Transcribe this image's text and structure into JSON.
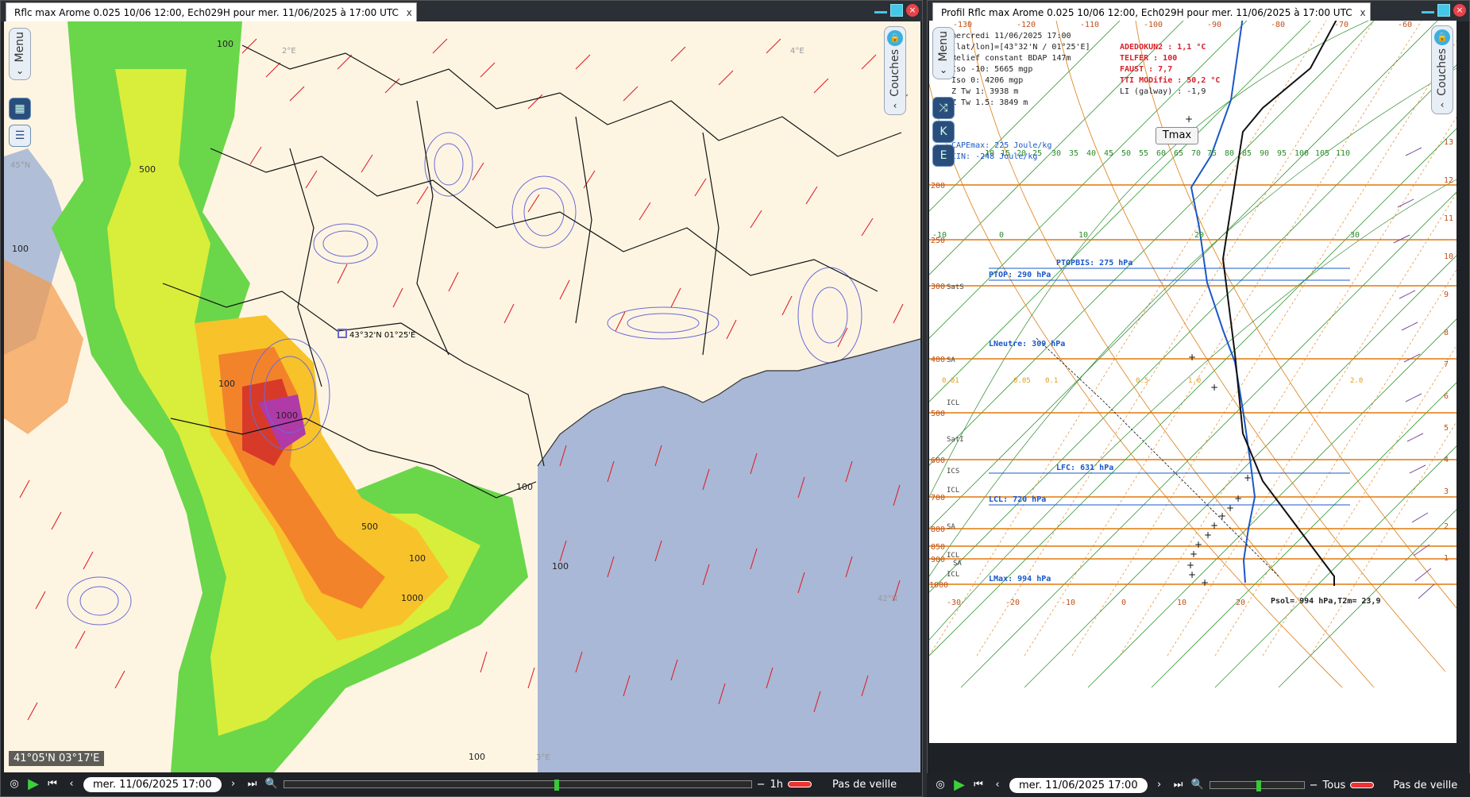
{
  "left_window": {
    "title": "Rflc max Arome 0.025 10/06 12:00, Ech029H pour mer. 11/06/2025 à 17:00 UTC",
    "tab_close": "x",
    "menu_label": "Menu",
    "layers_label": "Couches",
    "point_label": "43°32'N 01°25'E",
    "cursor_coord": "41°05'N 03°17'E",
    "contour_labels": [
      "100",
      "500",
      "100",
      "100",
      "1000",
      "500",
      "100",
      "100",
      "100",
      "1000",
      "100"
    ],
    "map_ticks": [
      "45°N",
      "2°E",
      "4°E",
      "42°N",
      "3°E"
    ],
    "controls": {
      "date": "mer. 11/06/2025 17:00",
      "step": "1h",
      "minus": "−",
      "watch": "Pas de veille"
    }
  },
  "right_window": {
    "title": "Profil Rflc max Arome 0.025 10/06 12:00, Ech029H pour mer. 11/06/2025 à 17:00 UTC",
    "tab_close": "x",
    "menu_label": "Menu",
    "layers_label": "Couches",
    "tmax_button": "Tmax",
    "info": {
      "date": "mercredi 11/06/2025 17:00",
      "latlon": "[lat/lon]=[43°32'N / 01°25'E]",
      "relief": "Relief constant BDAP  147m",
      "iso_m10": "Iso -10: 5665 mgp",
      "iso_0": "Iso 0: 4206 mgp",
      "ztw1": "Z Tw 1: 3938 m",
      "ztw15": "Z Tw 1.5: 3849 m",
      "cape": "CAPEmax: 225 Joule/kg",
      "cin": "CIN: -248 Joule/kg"
    },
    "indices": {
      "adedokun": "ADEDOKUN2 : 1,1 °C",
      "telfer": "TELFER : 100",
      "faust": "FAUST : 7,7",
      "tti": "TTI MODifie : 50,2 °C",
      "li": "LI (galway) : -1,9"
    },
    "levels": {
      "ptopbis": "PTOPBIS: 275 hPa",
      "ptop": "PTOP: 290 hPa",
      "lneutre": "LNeutre: 309 hPa",
      "lfc": "LFC: 631 hPa",
      "lcl": "LCL: 720 hPa",
      "lmax": "LMax: 994 hPa",
      "psol": "Psol= 994 hPa,T2m=  23,9"
    },
    "pressure_labels": [
      "200",
      "250",
      "300",
      "400",
      "500",
      "600",
      "700",
      "800",
      "850",
      "900",
      "1000"
    ],
    "side_markers": [
      "SatS",
      "SA",
      "ICL",
      "SatI",
      "ICS",
      "ICL",
      "SA",
      "ICL",
      "SA",
      "ICL"
    ],
    "temp_axis": [
      "-30",
      "-20",
      "-10",
      "0",
      "10",
      "20"
    ],
    "mixing_ratio_row": [
      "5",
      "10",
      "15",
      "20",
      "25",
      "30",
      "35",
      "40",
      "45",
      "50",
      "55",
      "60",
      "65",
      "70",
      "75",
      "80",
      "85",
      "90",
      "95",
      "100",
      "105",
      "110"
    ],
    "theta_row": [
      "-10",
      "0",
      "10",
      "20",
      "30"
    ],
    "top_axis": [
      "-130",
      "-120",
      "-110",
      "-100",
      "-90",
      "-80",
      "-70",
      "-60"
    ],
    "right_axis": [
      "13",
      "12",
      "11",
      "10",
      "9",
      "8",
      "7",
      "6",
      "5",
      "4",
      "3",
      "2",
      "1"
    ],
    "small_row": [
      "0.01",
      "0.05",
      "0.1",
      "0.5",
      "1.0",
      "2.0"
    ],
    "controls": {
      "date": "mer. 11/06/2025 17:00",
      "all": "Tous",
      "minus": "−",
      "watch": "Pas de veille"
    }
  }
}
